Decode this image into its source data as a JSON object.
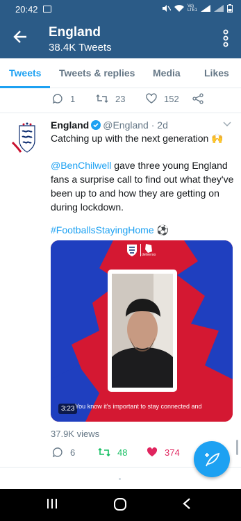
{
  "status": {
    "time": "20:42",
    "net": "Vo)\nLTE1"
  },
  "header": {
    "title": "England",
    "subtitle": "38.4K Tweets"
  },
  "tabs": [
    {
      "label": "Tweets",
      "active": true
    },
    {
      "label": "Tweets & replies"
    },
    {
      "label": "Media"
    },
    {
      "label": "Likes"
    }
  ],
  "prev_tweet": {
    "replies": "1",
    "retweets": "23",
    "likes": "152"
  },
  "tweet": {
    "name": "England",
    "handle": "@England",
    "sep": "·",
    "time": "2d",
    "line1": "Catching up with the next generation 🙌",
    "mention": "@BenChilwell",
    "body": " gave three young England fans a surprise call to find out what they've been up to and how they are getting on during lockdown.",
    "hashtag": "#FootballsStayingHome",
    "hashtag_emoji": "⚽",
    "media": {
      "duration": "3:23",
      "caption": "You know it's important to stay connected and",
      "brand": "deliveroo"
    },
    "views": "37.9K views",
    "replies": "6",
    "retweets": "48",
    "likes": "374"
  },
  "colors": {
    "brand_bar": "#2b5b87",
    "accent": "#1da1f2",
    "retweet": "#17bf63",
    "like": "#e0245e"
  }
}
